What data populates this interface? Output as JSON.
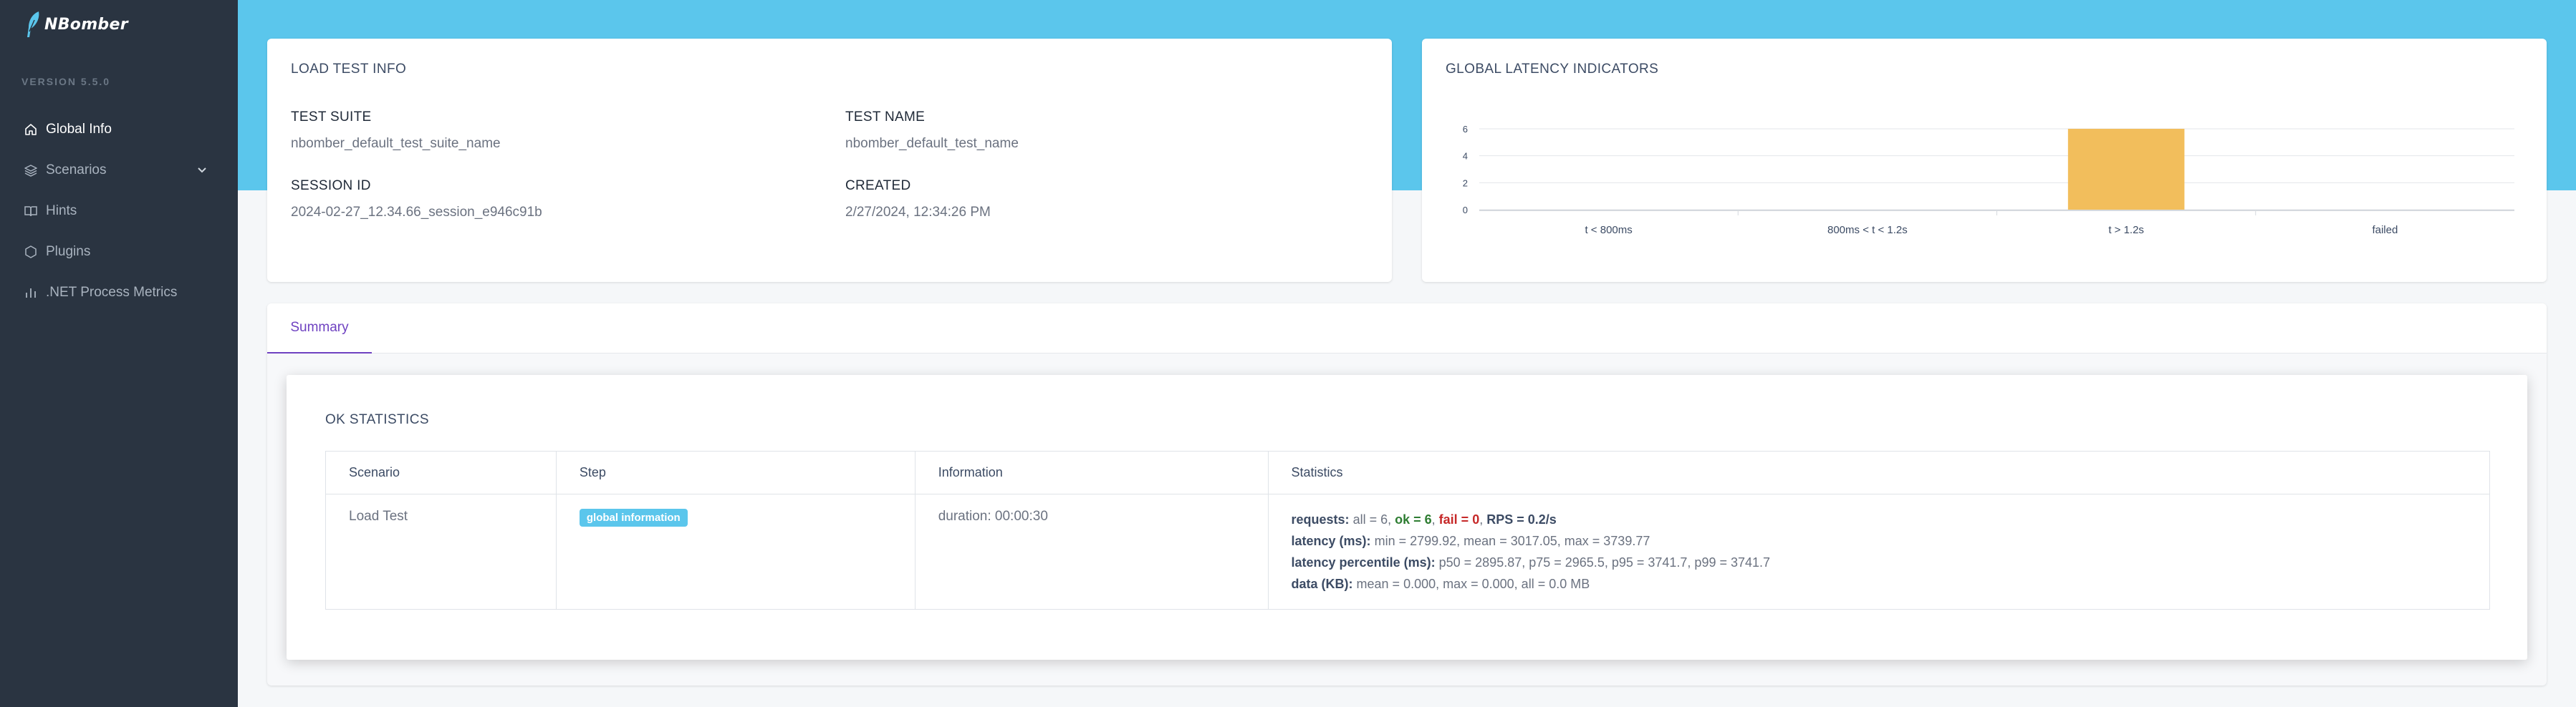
{
  "brand": {
    "name": "NBomber",
    "version": "VERSION 5.5.0"
  },
  "sidebar": {
    "items": [
      {
        "label": "Global Info",
        "icon": "home-icon",
        "active": true
      },
      {
        "label": "Scenarios",
        "icon": "layers-icon",
        "active": false
      },
      {
        "label": "Hints",
        "icon": "book-icon",
        "active": false
      },
      {
        "label": "Plugins",
        "icon": "hexagon-icon",
        "active": false
      },
      {
        "label": ".NET Process Metrics",
        "icon": "bar-chart-icon",
        "active": false
      }
    ]
  },
  "colors": {
    "accent": "#5bc6ec",
    "sidebar": "#2a3441",
    "bar": "#f2be5c",
    "tab_active": "#6f42c1",
    "ok": "#2e7d32",
    "fail": "#c62828"
  },
  "load_test_info": {
    "title": "LOAD TEST INFO",
    "test_suite_label": "TEST SUITE",
    "test_suite": "nbomber_default_test_suite_name",
    "test_name_label": "TEST NAME",
    "test_name": "nbomber_default_test_name",
    "session_id_label": "SESSION ID",
    "session_id": "2024-02-27_12.34.66_session_e946c91b",
    "created_label": "CREATED",
    "created": "2/27/2024, 12:34:26 PM"
  },
  "latency": {
    "title": "GLOBAL LATENCY INDICATORS"
  },
  "chart_data": {
    "type": "bar",
    "categories": [
      "t < 800ms",
      "800ms < t < 1.2s",
      "t > 1.2s",
      "failed"
    ],
    "values": [
      0,
      0,
      6,
      0
    ],
    "y_ticks": [
      "0",
      "2",
      "4",
      "6"
    ],
    "ylim": [
      0,
      6
    ],
    "grid": true,
    "bar_color": "#f2be5c"
  },
  "summary": {
    "tab_label": "Summary",
    "panel_title": "OK STATISTICS",
    "columns": [
      "Scenario",
      "Step",
      "Information",
      "Statistics"
    ],
    "row": {
      "scenario": "Load Test",
      "step": "global information",
      "information": "duration: 00:00:30",
      "requests_label": "requests:",
      "requests_all": "all = 6,",
      "requests_ok": "ok = 6",
      "requests_fail": "fail = 0",
      "requests_rps": "RPS = 0.2/s",
      "latency_label": "latency (ms):",
      "latency_values": "min = 2799.92, mean = 3017.05, max = 3739.77",
      "percentile_label": "latency percentile (ms):",
      "percentile_values": "p50 = 2895.87, p75 = 2965.5, p95 = 3741.7, p99 = 3741.7",
      "data_label": "data (KB):",
      "data_values": "mean = 0.000, max = 0.000, all = 0.0 MB"
    }
  }
}
